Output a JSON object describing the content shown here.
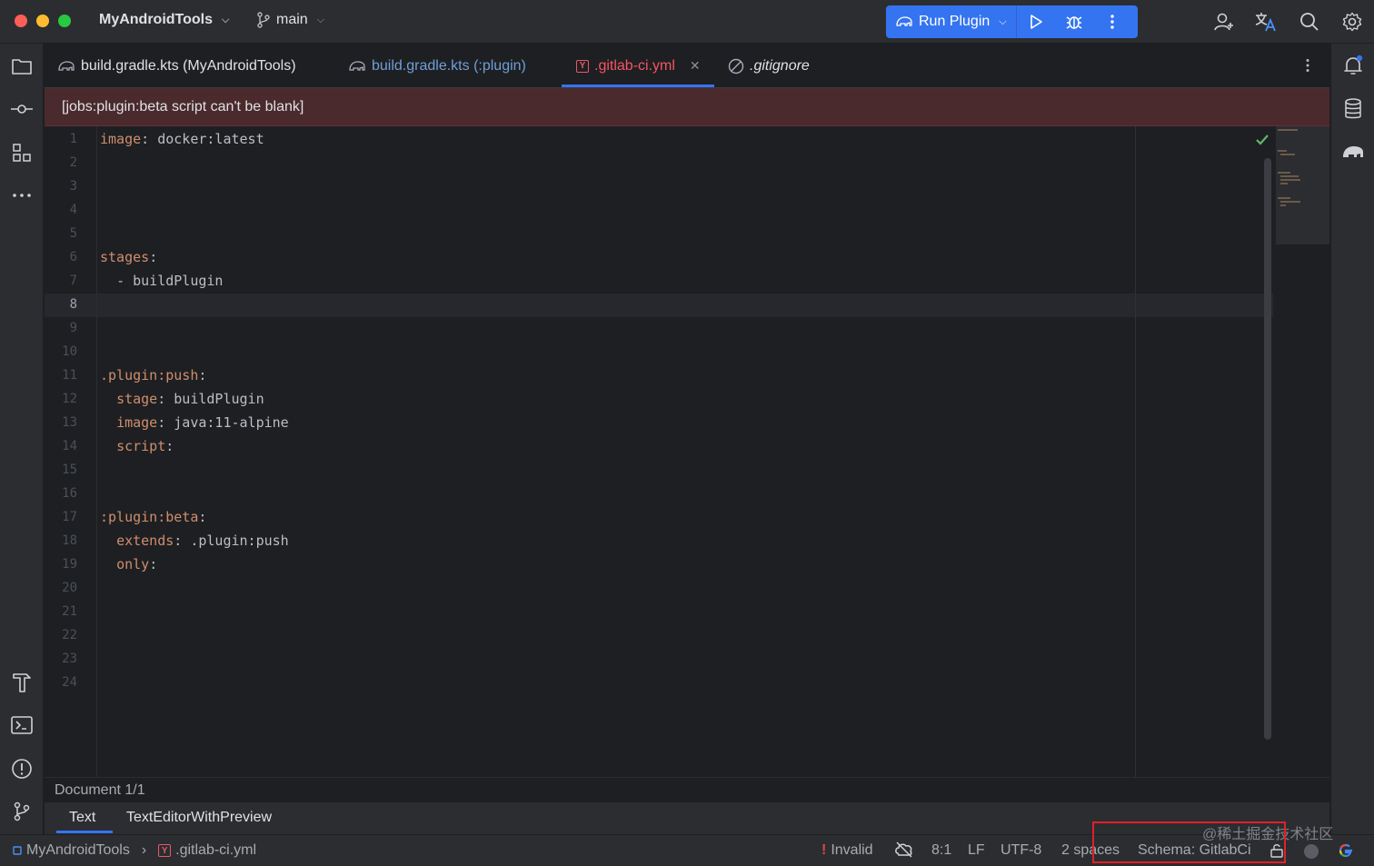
{
  "titlebar": {
    "project": "MyAndroidTools",
    "branch": "main",
    "run_config": "Run Plugin"
  },
  "tabs": [
    {
      "label": "build.gradle.kts (MyAndroidTools)"
    },
    {
      "label": "build.gradle.kts (:plugin)"
    },
    {
      "label": ".gitlab-ci.yml",
      "active": true
    },
    {
      "label": ".gitignore"
    }
  ],
  "banner": {
    "message": "[jobs:plugin:beta script can't be blank]"
  },
  "editor": {
    "line_numbers": [
      "1",
      "2",
      "3",
      "4",
      "5",
      "6",
      "7",
      "8",
      "9",
      "10",
      "11",
      "12",
      "13",
      "14",
      "15",
      "16",
      "17",
      "18",
      "19",
      "20",
      "21",
      "22",
      "23",
      "24"
    ],
    "current_line": 8,
    "lines": [
      {
        "key": "image",
        "sep": ": ",
        "value": "docker:latest"
      },
      {
        "key": "stages",
        "sep": ":",
        "value": ""
      },
      {
        "indent": "  ",
        "dash": "- ",
        "value": "buildPlugin"
      },
      {
        "key": ".plugin:push",
        "sep": ":",
        "value": ""
      },
      {
        "indent": "  ",
        "key": "stage",
        "sep": ": ",
        "value": "buildPlugin"
      },
      {
        "indent": "  ",
        "key": "image",
        "sep": ": ",
        "value": "java:11-alpine"
      },
      {
        "indent": "  ",
        "key": "script",
        "sep": ":",
        "value": ""
      },
      {
        "key": ":plugin:beta",
        "sep": ":",
        "value": ""
      },
      {
        "indent": "  ",
        "key": "extends",
        "sep": ": ",
        "value": ".plugin:push"
      },
      {
        "indent": "  ",
        "key": "only",
        "sep": ":",
        "value": ""
      }
    ]
  },
  "docpanel": {
    "label": "Document 1/1",
    "tabs": [
      "Text",
      "TextEditorWithPreview"
    ]
  },
  "statusbar": {
    "breadcrumb_project": "MyAndroidTools",
    "breadcrumb_file": ".gitlab-ci.yml",
    "validation": "Invalid",
    "position": "8:1",
    "line_ending": "LF",
    "encoding": "UTF-8",
    "indent": "2 spaces",
    "schema": "Schema: GitlabCi"
  },
  "watermark": "@稀土掘金技术社区",
  "colors": {
    "accent": "#3574f0",
    "error": "#f75464",
    "key": "#cf8e6d",
    "highlight_box": "#e0202a"
  }
}
